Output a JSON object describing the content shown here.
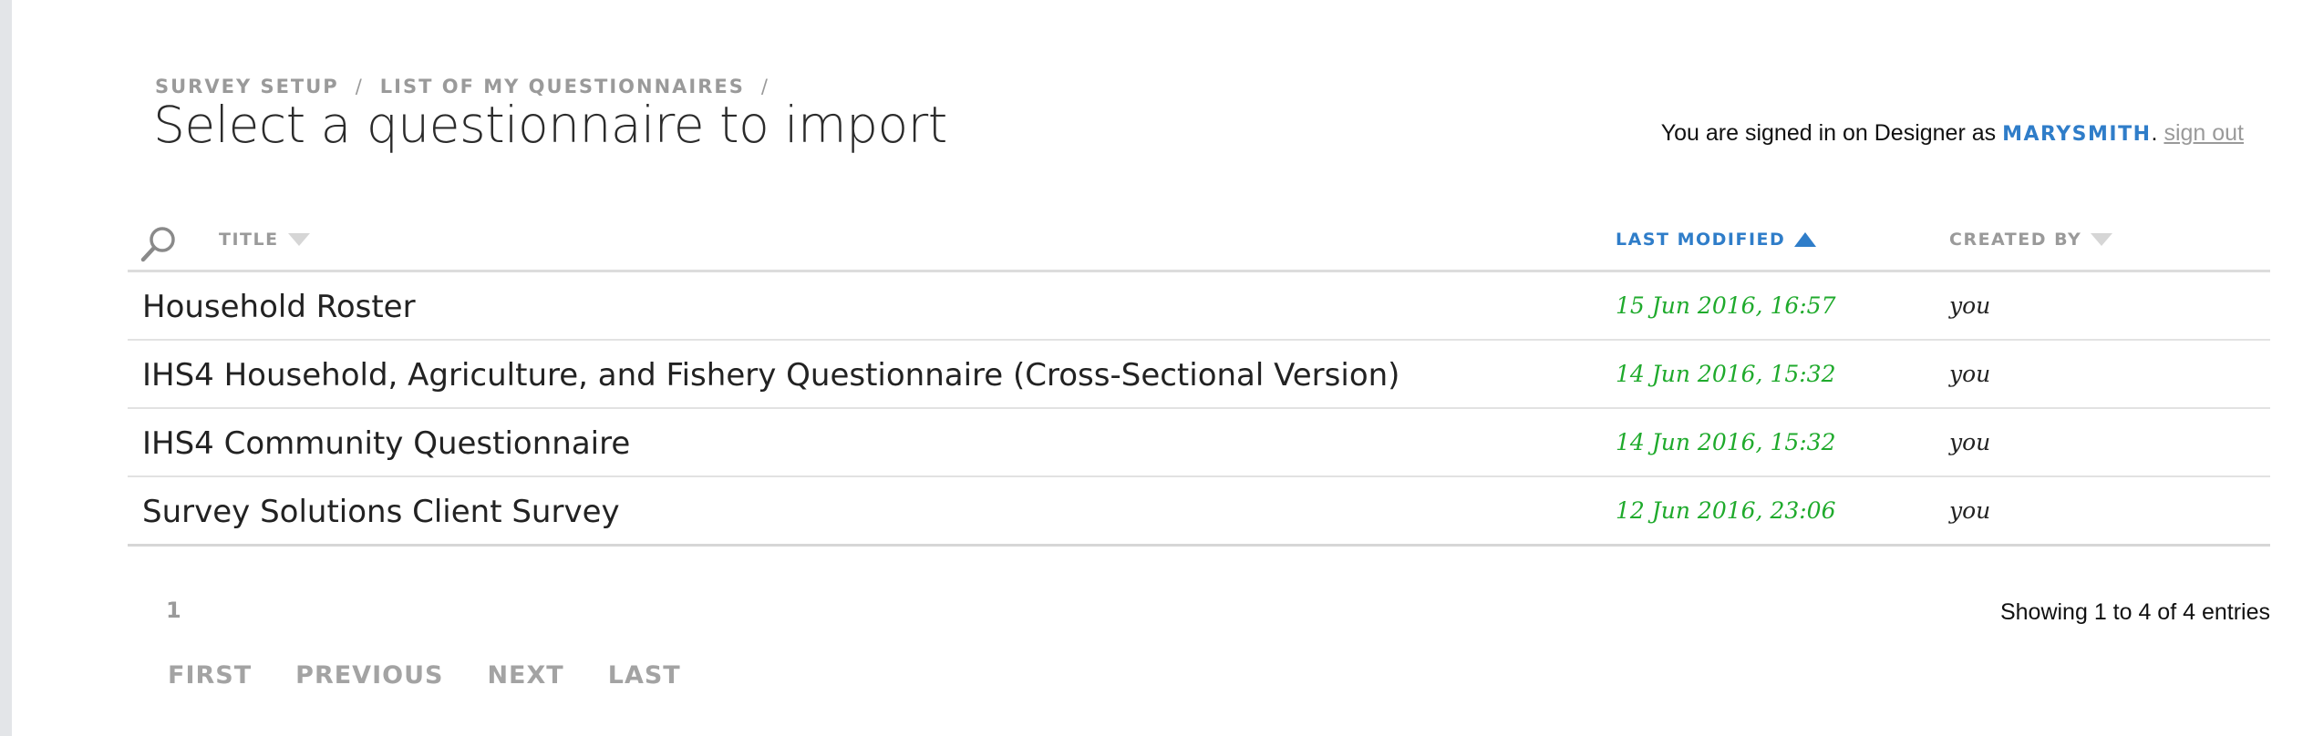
{
  "breadcrumb": {
    "items": [
      "SURVEY SETUP",
      "LIST OF MY QUESTIONNAIRES"
    ],
    "separator": "/"
  },
  "page_title": "Select a questionnaire to import",
  "signin": {
    "prefix": "You are signed in on Designer as",
    "username": "MARYSMITH",
    "period": ".",
    "signout_label": "sign out"
  },
  "table": {
    "search_icon": "search-icon",
    "columns": {
      "title": "TITLE",
      "last_modified": "LAST MODIFIED",
      "created_by": "CREATED BY"
    },
    "sort": {
      "column": "last_modified",
      "direction": "ascending"
    },
    "rows": [
      {
        "title": "Household Roster",
        "last_modified": "15 Jun 2016, 16:57",
        "created_by": "you"
      },
      {
        "title": "IHS4 Household, Agriculture, and Fishery Questionnaire (Cross-Sectional Version)",
        "last_modified": "14 Jun 2016, 15:32",
        "created_by": "you"
      },
      {
        "title": "IHS4 Community Questionnaire",
        "last_modified": "14 Jun 2016, 15:32",
        "created_by": "you"
      },
      {
        "title": "Survey Solutions Client Survey",
        "last_modified": "12 Jun 2016, 23:06",
        "created_by": "you"
      }
    ]
  },
  "pagination": {
    "current_page": "1",
    "first": "FIRST",
    "previous": "PREVIOUS",
    "next": "NEXT",
    "last": "LAST",
    "entries_text": "Showing 1 to 4 of 4 entries"
  },
  "colors": {
    "accent": "#2f7dc9",
    "date_green": "#1faa2c",
    "muted": "#9a9a9a"
  }
}
